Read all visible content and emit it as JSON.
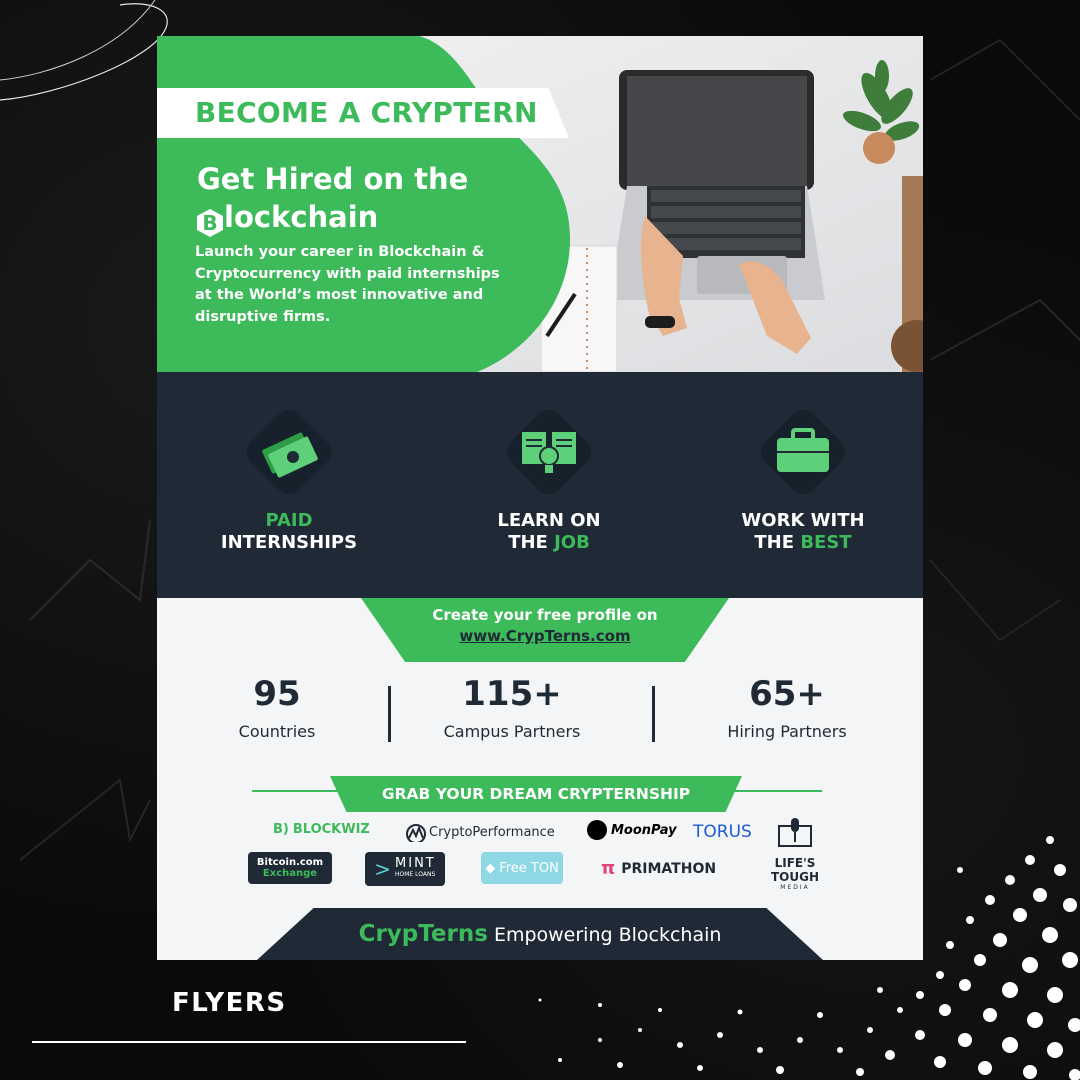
{
  "hero": {
    "ribbon": "BECOME A CRYPTERN",
    "title_line1": "Get Hired on the",
    "title_badge": "B",
    "title_line2_rest": "lockchain",
    "description": "Launch your career in Blockchain & Cryptocurrency with paid internships at the World’s most innovative and disruptive firms."
  },
  "features": [
    {
      "line1": "PAID",
      "line2": "INTERNSHIPS",
      "icon": "money-icon"
    },
    {
      "line1": "LEARN ON",
      "line2_a": "THE ",
      "line2_b": "JOB",
      "icon": "book-lightbulb-icon"
    },
    {
      "line1": "WORK WITH",
      "line2_a": "THE ",
      "line2_b": "BEST",
      "icon": "briefcase-icon"
    }
  ],
  "cta": {
    "line1": "Create your free profile on",
    "link": "www.CrypTerns.com"
  },
  "stats": [
    {
      "number": "95",
      "caption": "Countries"
    },
    {
      "number": "115+",
      "caption": "Campus Partners"
    },
    {
      "number": "65+",
      "caption": "Hiring Partners"
    }
  ],
  "grab_label": "GRAB YOUR DREAM CRYPTERNSHIP",
  "logos": {
    "blockwiz": "BLOCKWIZ",
    "cryptoperformance": "CryptoPerformance",
    "moonpay": "MoonPay",
    "torus": "TORUS",
    "bitcoin_exchange_l1": "Bitcoin.com",
    "bitcoin_exchange_l2": "Exchange",
    "mint": "MINT",
    "mint_sub": "HOME LOANS",
    "freeton": "Free TON",
    "primathon": "PRIMATHON",
    "lifes_tough": "LIFE'S TOUGH",
    "lifes_tough_sub": "MEDIA"
  },
  "footer": {
    "brand": "CrypTerns",
    "tagline": "Empowering Blockchain"
  },
  "caption": "FLYERS",
  "colors": {
    "green": "#3dba5a",
    "navy": "#1f2a36"
  }
}
